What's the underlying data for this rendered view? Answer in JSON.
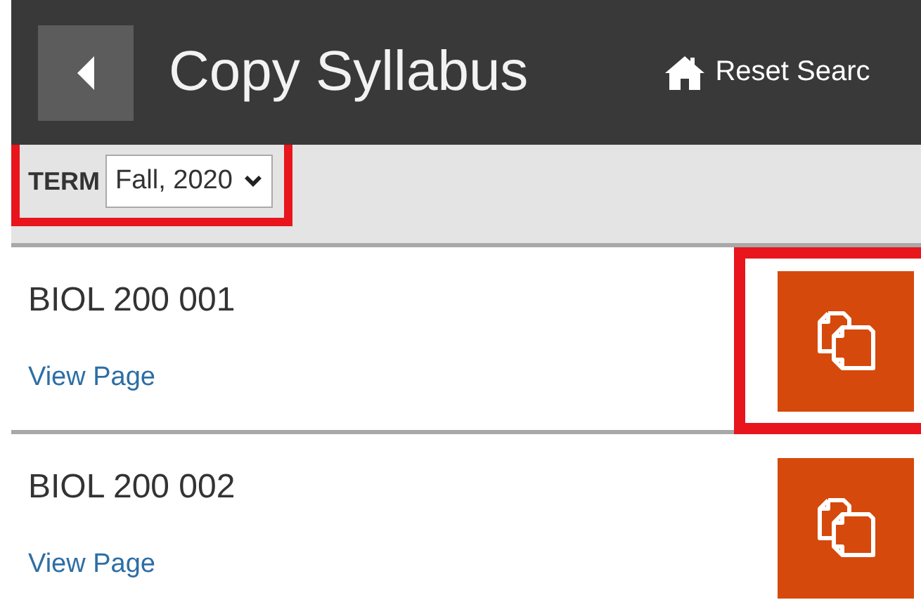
{
  "header": {
    "title": "Copy Syllabus",
    "reset_link": "Reset Searc"
  },
  "term_bar": {
    "label": "TERM",
    "value": "Fall, 2020",
    "highlighted": true
  },
  "courses": [
    {
      "name": "BIOL 200 001",
      "link": "View Page",
      "highlighted": true
    },
    {
      "name": "BIOL 200 002",
      "link": "View Page",
      "highlighted": false
    }
  ]
}
